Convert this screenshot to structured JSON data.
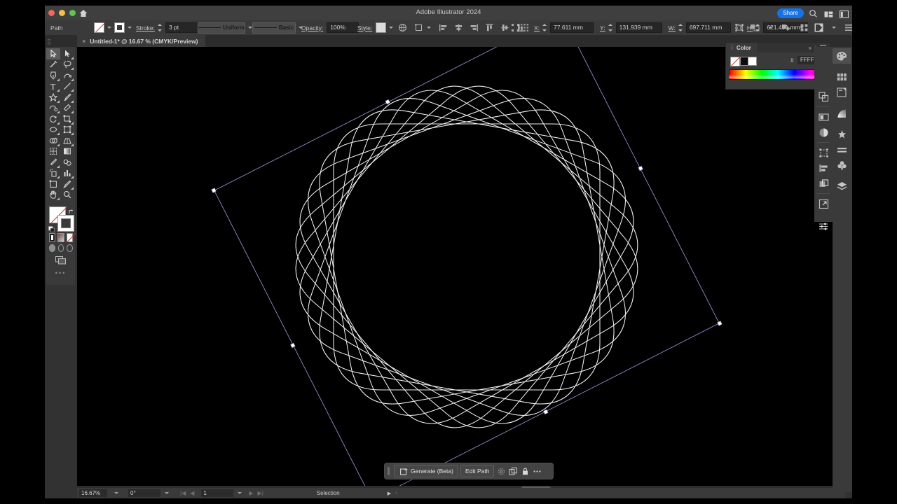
{
  "window": {
    "app_title": "Adobe Illustrator 2024",
    "share_label": "Share",
    "icons": [
      "home-icon",
      "search-icon",
      "arrange-documents-icon",
      "workspace-switcher-icon"
    ]
  },
  "control_bar": {
    "object_type": "Path",
    "fill_label": "fill-swatch",
    "stroke_swatch_label": "stroke-swatch",
    "stroke_label": "Stroke:",
    "stroke_weight": "3 pt",
    "stroke_profile": "Uniform",
    "brush_definition": "Basic",
    "opacity_label": "Opacity:",
    "opacity_value": "100%",
    "style_label": "Style:",
    "x_label": "X:",
    "x_value": "77.611 mm",
    "y_label": "Y:",
    "y_value": "131.939 mm",
    "w_label": "W:",
    "w_value": "697.711 mm",
    "h_label": "H:",
    "h_value": "621.491 mm",
    "align_icons": [
      "align-left-icon",
      "align-center-h-icon",
      "align-right-icon",
      "align-top-icon",
      "align-center-v-icon",
      "align-bottom-icon"
    ],
    "right_icons": [
      "transform-icon",
      "arrange-icon",
      "select-similar-icon",
      "distribute-icon",
      "make-clip-icon",
      "document-setup-icon"
    ]
  },
  "document_tab": {
    "close_label": "×",
    "title": "Untitled-1* @ 16.67 % (CMYK/Preview)"
  },
  "toolbar": {
    "tools": [
      {
        "name": "selection-tool",
        "selected": true
      },
      {
        "name": "direct-selection-tool",
        "selected": false
      },
      {
        "name": "magic-wand-tool",
        "selected": false
      },
      {
        "name": "lasso-tool",
        "selected": false
      },
      {
        "name": "pen-tool",
        "selected": false
      },
      {
        "name": "curvature-tool",
        "selected": false
      },
      {
        "name": "type-tool",
        "selected": false
      },
      {
        "name": "line-segment-tool",
        "selected": false
      },
      {
        "name": "shape-tool",
        "selected": false
      },
      {
        "name": "paintbrush-tool",
        "selected": false
      },
      {
        "name": "shaper-tool",
        "selected": false
      },
      {
        "name": "eraser-tool",
        "selected": false
      },
      {
        "name": "rotate-tool",
        "selected": false
      },
      {
        "name": "scale-tool",
        "selected": false
      },
      {
        "name": "width-tool",
        "selected": false
      },
      {
        "name": "free-transform-tool",
        "selected": false
      },
      {
        "name": "shape-builder-tool",
        "selected": false
      },
      {
        "name": "perspective-grid-tool",
        "selected": false
      },
      {
        "name": "mesh-tool",
        "selected": false
      },
      {
        "name": "gradient-tool",
        "selected": false
      },
      {
        "name": "eyedropper-tool",
        "selected": false
      },
      {
        "name": "blend-tool",
        "selected": false
      },
      {
        "name": "symbol-sprayer-tool",
        "selected": false
      },
      {
        "name": "column-graph-tool",
        "selected": false
      },
      {
        "name": "artboard-tool",
        "selected": false
      },
      {
        "name": "slice-tool",
        "selected": false
      },
      {
        "name": "hand-tool",
        "selected": false
      },
      {
        "name": "zoom-tool",
        "selected": false
      }
    ],
    "fill_stroke": {
      "fill": "none",
      "stroke": "#FFFFFF",
      "swap_icon": "swap-fill-stroke-icon",
      "default_icon": "default-fill-stroke-icon"
    },
    "color_modes": [
      "color-swatch-mode",
      "gradient-mode",
      "none-mode"
    ],
    "draw_modes": [
      "draw-normal",
      "draw-behind",
      "draw-inside"
    ],
    "screen_mode": "change-screen-mode-icon",
    "more_label": "•••"
  },
  "color_panel": {
    "title": "Color",
    "collapse_icon": "»",
    "menu_icon": "panel-menu-icon",
    "hash": "#",
    "hex_value": "FFFFFF",
    "spectrum": "color-spectrum-ramp"
  },
  "contextual_toolbar": {
    "generate_label": "Generate (Beta)",
    "edit_path_label": "Edit Path",
    "icons": [
      "recolor-icon",
      "duplicate-icon",
      "lock-icon",
      "more-options-icon"
    ]
  },
  "status_bar": {
    "zoom": "16.67%",
    "rotation": "0°",
    "page": "1",
    "tool_status": "Selection"
  },
  "dock": {
    "inner_icons": [
      "properties-icon",
      "appearance-icon",
      "opacity-icon",
      "transform-icon",
      "align-icon",
      "pathfinder-icon",
      "expand-icon",
      "settings-icon"
    ],
    "outer_icons": [
      "color-icon",
      "swatches-icon",
      "color-guide-icon",
      "gradient-icon",
      "brushes-icon",
      "stroke-icon",
      "symbols-icon",
      "layers-icon"
    ],
    "selected": "color-icon"
  },
  "artwork": {
    "description": "spirograph-style layered rounded-octagon paths",
    "stroke_color": "#FFFFFF",
    "path_count": 9,
    "selection": {
      "box_color": "#8e8ecb",
      "handle_color": "#FFFFFF",
      "rotation_deg": -27,
      "handles": 8
    }
  }
}
